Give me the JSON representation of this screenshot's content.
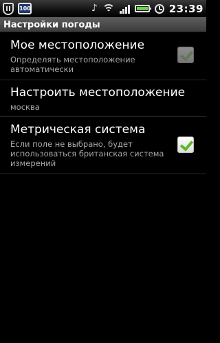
{
  "status_bar": {
    "battery_badge": "100",
    "time": "23:39"
  },
  "title_bar": {
    "title": "Настройки погоды"
  },
  "preferences": [
    {
      "title": "Мое местоположение",
      "summary": "Определять местоположение автоматически",
      "checked": true,
      "enabled": false
    },
    {
      "title": "Настроить местоположение",
      "summary": "москва"
    },
    {
      "title": "Метрическая система",
      "summary": "Если поле не выбрано, будет использоваться британская система измерений",
      "checked": true,
      "enabled": true
    }
  ],
  "colors": {
    "background": "#000000",
    "summary_text": "#a9a9a9",
    "check_green": "#5bb82a",
    "battery_green": "#6cd04a"
  }
}
